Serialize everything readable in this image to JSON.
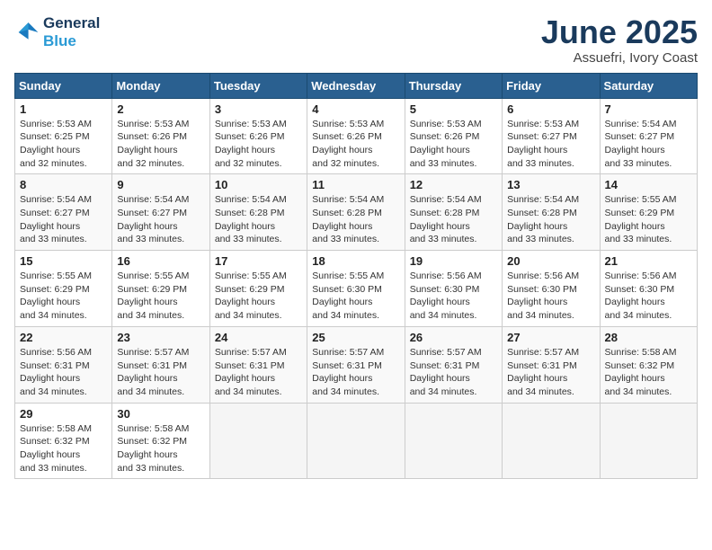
{
  "logo": {
    "line1": "General",
    "line2": "Blue"
  },
  "title": "June 2025",
  "subtitle": "Assuefri, Ivory Coast",
  "days_of_week": [
    "Sunday",
    "Monday",
    "Tuesday",
    "Wednesday",
    "Thursday",
    "Friday",
    "Saturday"
  ],
  "weeks": [
    [
      {
        "num": "1",
        "sunrise": "5:53 AM",
        "sunset": "6:25 PM",
        "daylight": "12 hours and 32 minutes."
      },
      {
        "num": "2",
        "sunrise": "5:53 AM",
        "sunset": "6:26 PM",
        "daylight": "12 hours and 32 minutes."
      },
      {
        "num": "3",
        "sunrise": "5:53 AM",
        "sunset": "6:26 PM",
        "daylight": "12 hours and 32 minutes."
      },
      {
        "num": "4",
        "sunrise": "5:53 AM",
        "sunset": "6:26 PM",
        "daylight": "12 hours and 32 minutes."
      },
      {
        "num": "5",
        "sunrise": "5:53 AM",
        "sunset": "6:26 PM",
        "daylight": "12 hours and 33 minutes."
      },
      {
        "num": "6",
        "sunrise": "5:53 AM",
        "sunset": "6:27 PM",
        "daylight": "12 hours and 33 minutes."
      },
      {
        "num": "7",
        "sunrise": "5:54 AM",
        "sunset": "6:27 PM",
        "daylight": "12 hours and 33 minutes."
      }
    ],
    [
      {
        "num": "8",
        "sunrise": "5:54 AM",
        "sunset": "6:27 PM",
        "daylight": "12 hours and 33 minutes."
      },
      {
        "num": "9",
        "sunrise": "5:54 AM",
        "sunset": "6:27 PM",
        "daylight": "12 hours and 33 minutes."
      },
      {
        "num": "10",
        "sunrise": "5:54 AM",
        "sunset": "6:28 PM",
        "daylight": "12 hours and 33 minutes."
      },
      {
        "num": "11",
        "sunrise": "5:54 AM",
        "sunset": "6:28 PM",
        "daylight": "12 hours and 33 minutes."
      },
      {
        "num": "12",
        "sunrise": "5:54 AM",
        "sunset": "6:28 PM",
        "daylight": "12 hours and 33 minutes."
      },
      {
        "num": "13",
        "sunrise": "5:54 AM",
        "sunset": "6:28 PM",
        "daylight": "12 hours and 33 minutes."
      },
      {
        "num": "14",
        "sunrise": "5:55 AM",
        "sunset": "6:29 PM",
        "daylight": "12 hours and 33 minutes."
      }
    ],
    [
      {
        "num": "15",
        "sunrise": "5:55 AM",
        "sunset": "6:29 PM",
        "daylight": "12 hours and 34 minutes."
      },
      {
        "num": "16",
        "sunrise": "5:55 AM",
        "sunset": "6:29 PM",
        "daylight": "12 hours and 34 minutes."
      },
      {
        "num": "17",
        "sunrise": "5:55 AM",
        "sunset": "6:29 PM",
        "daylight": "12 hours and 34 minutes."
      },
      {
        "num": "18",
        "sunrise": "5:55 AM",
        "sunset": "6:30 PM",
        "daylight": "12 hours and 34 minutes."
      },
      {
        "num": "19",
        "sunrise": "5:56 AM",
        "sunset": "6:30 PM",
        "daylight": "12 hours and 34 minutes."
      },
      {
        "num": "20",
        "sunrise": "5:56 AM",
        "sunset": "6:30 PM",
        "daylight": "12 hours and 34 minutes."
      },
      {
        "num": "21",
        "sunrise": "5:56 AM",
        "sunset": "6:30 PM",
        "daylight": "12 hours and 34 minutes."
      }
    ],
    [
      {
        "num": "22",
        "sunrise": "5:56 AM",
        "sunset": "6:31 PM",
        "daylight": "12 hours and 34 minutes."
      },
      {
        "num": "23",
        "sunrise": "5:57 AM",
        "sunset": "6:31 PM",
        "daylight": "12 hours and 34 minutes."
      },
      {
        "num": "24",
        "sunrise": "5:57 AM",
        "sunset": "6:31 PM",
        "daylight": "12 hours and 34 minutes."
      },
      {
        "num": "25",
        "sunrise": "5:57 AM",
        "sunset": "6:31 PM",
        "daylight": "12 hours and 34 minutes."
      },
      {
        "num": "26",
        "sunrise": "5:57 AM",
        "sunset": "6:31 PM",
        "daylight": "12 hours and 34 minutes."
      },
      {
        "num": "27",
        "sunrise": "5:57 AM",
        "sunset": "6:31 PM",
        "daylight": "12 hours and 34 minutes."
      },
      {
        "num": "28",
        "sunrise": "5:58 AM",
        "sunset": "6:32 PM",
        "daylight": "12 hours and 34 minutes."
      }
    ],
    [
      {
        "num": "29",
        "sunrise": "5:58 AM",
        "sunset": "6:32 PM",
        "daylight": "12 hours and 33 minutes."
      },
      {
        "num": "30",
        "sunrise": "5:58 AM",
        "sunset": "6:32 PM",
        "daylight": "12 hours and 33 minutes."
      },
      null,
      null,
      null,
      null,
      null
    ]
  ]
}
